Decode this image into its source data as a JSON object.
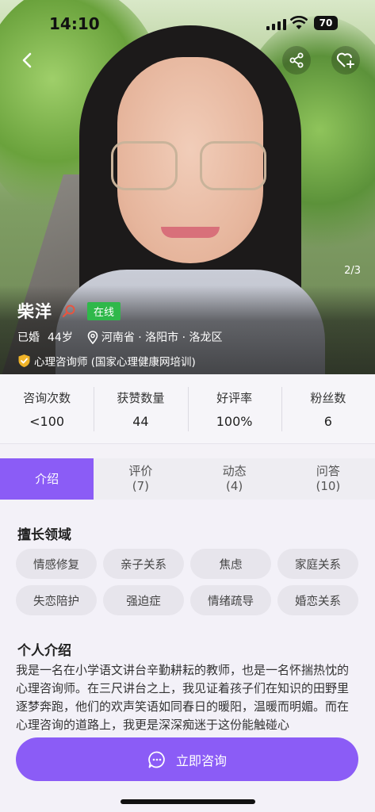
{
  "status_bar": {
    "time": "14:10",
    "battery": "70"
  },
  "hero": {
    "page_indicator": "2/3"
  },
  "profile": {
    "name": "柴洋",
    "online_badge": "在线",
    "marital": "已婚",
    "age": "44岁",
    "location": "河南省 · 洛阳市 · 洛龙区",
    "certification": "心理咨询师 (国家心理健康网培训)"
  },
  "stats": [
    {
      "label": "咨询次数",
      "value": "<100"
    },
    {
      "label": "获赞数量",
      "value": "44"
    },
    {
      "label": "好评率",
      "value": "100%"
    },
    {
      "label": "粉丝数",
      "value": "6"
    }
  ],
  "tabs": [
    {
      "label": "介绍",
      "count": ""
    },
    {
      "label": "评价",
      "count": "(7)"
    },
    {
      "label": "动态",
      "count": "(4)"
    },
    {
      "label": "问答",
      "count": "(10)"
    }
  ],
  "specialties": {
    "title": "擅长领域",
    "items": [
      "情感修复",
      "亲子关系",
      "焦虑",
      "家庭关系",
      "失恋陪护",
      "强迫症",
      "情绪疏导",
      "婚恋关系"
    ]
  },
  "intro": {
    "title": "个人介绍",
    "text": "我是一名在小学语文讲台辛勤耕耘的教师，也是一名怀揣热忱的心理咨询师。在三尺讲台之上，我见证着孩子们在知识的田野里逐梦奔跑，他们的欢声笑语如同春日的暖阳，温暖而明媚。而在心理咨询的道路上，我更是深深痴迷于这份能触碰心"
  },
  "cta": {
    "label": "立即咨询"
  },
  "colors": {
    "accent": "#8b5cf6",
    "online": "#2fb84a",
    "badge": "#f0b429"
  }
}
